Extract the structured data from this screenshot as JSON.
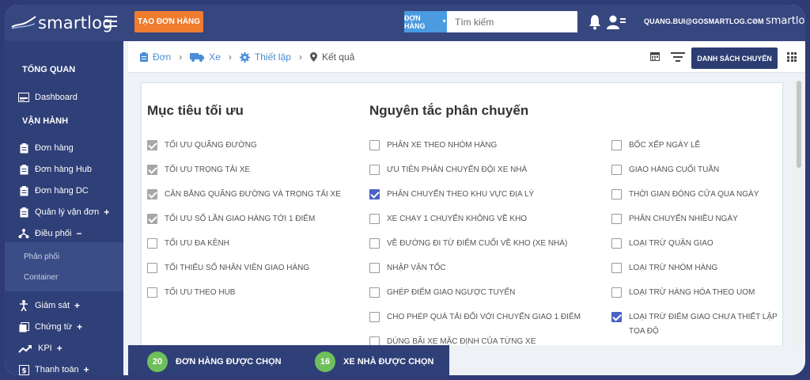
{
  "header": {
    "brand": "smartlog",
    "create_order_label": "TẠO ĐƠN HÀNG",
    "search_type_label": "ĐƠN HÀNG",
    "search_placeholder": "Tìm kiếm",
    "user_email": "QUANG.BUI@GOSMARTLOG.COM",
    "brand_small": "smartlog",
    "colors": {
      "topbar": "#36467f",
      "create": "#ef7c2f",
      "search_type": "#4a9be0"
    }
  },
  "sidebar": {
    "section_overview": "TỔNG QUAN",
    "dashboard": "Dashboard",
    "section_operation": "VẬN HÀNH",
    "items": [
      {
        "label": "Đơn hàng",
        "icon": "clipboard-icon"
      },
      {
        "label": "Đơn hàng Hub",
        "icon": "clipboard-icon"
      },
      {
        "label": "Đơn hàng DC",
        "icon": "clipboard-icon"
      },
      {
        "label": "Quản lý vận đơn",
        "icon": "clipboard-icon",
        "toggle": "+"
      },
      {
        "label": "Điều phối",
        "icon": "network-icon",
        "toggle": "−"
      }
    ],
    "submenu": [
      "Phân phối",
      "Container"
    ],
    "items_after": [
      {
        "label": "Giám sát",
        "icon": "person-icon",
        "toggle": "+"
      },
      {
        "label": "Chứng từ",
        "icon": "documents-icon",
        "toggle": "+"
      },
      {
        "label": "KPI",
        "icon": "trend-icon",
        "toggle": "+"
      },
      {
        "label": "Thanh toán",
        "icon": "dollar-icon",
        "toggle": "+"
      }
    ]
  },
  "breadcrumb": [
    {
      "label": "Đơn",
      "icon": "clipboard-icon"
    },
    {
      "label": "Xe",
      "icon": "truck-icon"
    },
    {
      "label": "Thiết lập",
      "icon": "gear-icon"
    },
    {
      "label": "Kết quả",
      "icon": "pin-icon"
    }
  ],
  "toolbar": {
    "list_button": "DANH SÁCH CHUYẾN"
  },
  "objectives": {
    "title": "Mục tiêu tối ưu",
    "options": [
      {
        "label": "TỐI ƯU QUÃNG ĐƯỜNG",
        "checked": true
      },
      {
        "label": "TỐI ƯU TRỌNG TẢI XE",
        "checked": true
      },
      {
        "label": "CÂN BẰNG QUÃNG ĐƯỜNG VÀ TRỌNG TẢI XE",
        "checked": true
      },
      {
        "label": "TỐI ƯU SỐ LẦN GIAO HÀNG TỚI 1 ĐIỂM",
        "checked": true
      },
      {
        "label": "TỐI ƯU ĐA KÊNH",
        "checked": false
      },
      {
        "label": "TỐI THIỂU SỐ NHÂN VIÊN GIAO HÀNG",
        "checked": false
      },
      {
        "label": "TỐI ƯU THEO HUB",
        "checked": false
      }
    ]
  },
  "principles": {
    "title": "Nguyên tắc phân chuyến",
    "col1": [
      {
        "label": "PHÂN XE THEO NHÓM HÀNG",
        "checked": false
      },
      {
        "label": "ƯU TIÊN PHÂN CHUYẾN ĐỘI XE NHÀ",
        "checked": false
      },
      {
        "label": "PHÂN CHUYẾN THEO KHU VỰC ĐỊA LÝ",
        "checked": true
      },
      {
        "label": "XE CHẠY 1 CHUYẾN KHÔNG VỀ KHO",
        "checked": false
      },
      {
        "label": "VỀ ĐƯỜNG ĐI TỪ ĐIỂM CUỐI VỀ KHO (XE NHÀ)",
        "checked": false
      },
      {
        "label": "NHẬP VẬN TỐC",
        "checked": false
      },
      {
        "label": "GHÉP ĐIỂM GIAO NGƯỢC TUYẾN",
        "checked": false
      },
      {
        "label": "CHO PHÉP QUÁ TẢI ĐỐI VỚI CHUYẾN GIAO 1 ĐIỂM",
        "checked": false
      },
      {
        "label": "DÙNG BÃI XE MẶC ĐỊNH CỦA TỪNG XE",
        "checked": false
      }
    ],
    "col2": [
      {
        "label": "BỐC XẾP NGÀY LỄ",
        "checked": false
      },
      {
        "label": "GIAO HÀNG CUỐI TUẦN",
        "checked": false
      },
      {
        "label": "THỜI GIAN ĐÓNG CỬA QUA NGÀY",
        "checked": false
      },
      {
        "label": "PHÂN CHUYẾN NHIỀU NGÀY",
        "checked": false
      },
      {
        "label": "LOẠI TRỪ QUẬN GIAO",
        "checked": false
      },
      {
        "label": "LOẠI TRỪ NHÓM HÀNG",
        "checked": false
      },
      {
        "label": "LOẠI TRỪ HÀNG HÓA THEO UOM",
        "checked": false
      },
      {
        "label": "LOẠI TRỪ ĐIỂM GIAO CHƯA THIẾT LẬP TỌA ĐỘ",
        "checked": true
      }
    ]
  },
  "summary": {
    "orders_count": "20",
    "orders_label": "ĐƠN HÀNG ĐƯỢC CHỌN",
    "trucks_count": "16",
    "trucks_label": "XE NHÀ ĐƯỢC CHỌN"
  }
}
